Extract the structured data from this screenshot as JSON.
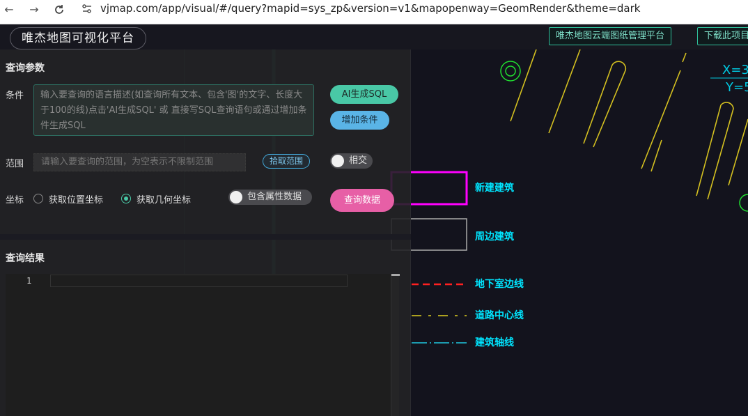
{
  "browser": {
    "back_icon": "arrow-left-icon",
    "forward_icon": "arrow-right-icon",
    "reload_icon": "reload-icon",
    "url": "vjmap.com/app/visual/#/query?mapid=sys_zp&version=v1&mapopenway=GeomRender&theme=dark"
  },
  "header": {
    "brand": "唯杰地图可视化平台",
    "link_cloud": "唯杰地图云端图纸管理平台",
    "link_download": "下载此项目"
  },
  "panel": {
    "query_params_title": "查询参数",
    "condition_label": "条件",
    "condition_placeholder": "输入要查询的语言描述(如查询所有文本、包含'图'的文字、长度大于100的线)点击'AI生成SQL' 或 直接写SQL查询语句或通过增加条件生成SQL",
    "ai_button": "AI生成SQL",
    "add_condition_button": "增加条件",
    "range_label": "范围",
    "range_placeholder": "请输入要查询的范围，为空表示不限制范围",
    "pick_range_button": "拾取范围",
    "intersect_toggle": "相交",
    "coord_label": "坐标",
    "radio_position": "获取位置坐标",
    "radio_geometry": "获取几何坐标",
    "include_attr_toggle": "包含属性数据",
    "query_button": "查询数据",
    "results_title": "查询结果",
    "editor_line_number": "1"
  },
  "map": {
    "legend": [
      {
        "label": "新建建筑",
        "color": "#ff00ff"
      },
      {
        "label": "周边建筑",
        "color": "#aaaaaa"
      },
      {
        "label": "地下室边线",
        "color": "#ff2020"
      },
      {
        "label": "道路中心线",
        "color": "#e0d020"
      },
      {
        "label": "建筑轴线",
        "color": "#20c8e0"
      }
    ],
    "coord_text_x": "X=3",
    "coord_text_y": "Y=5",
    "legend_text_color": "#00e5ff"
  }
}
